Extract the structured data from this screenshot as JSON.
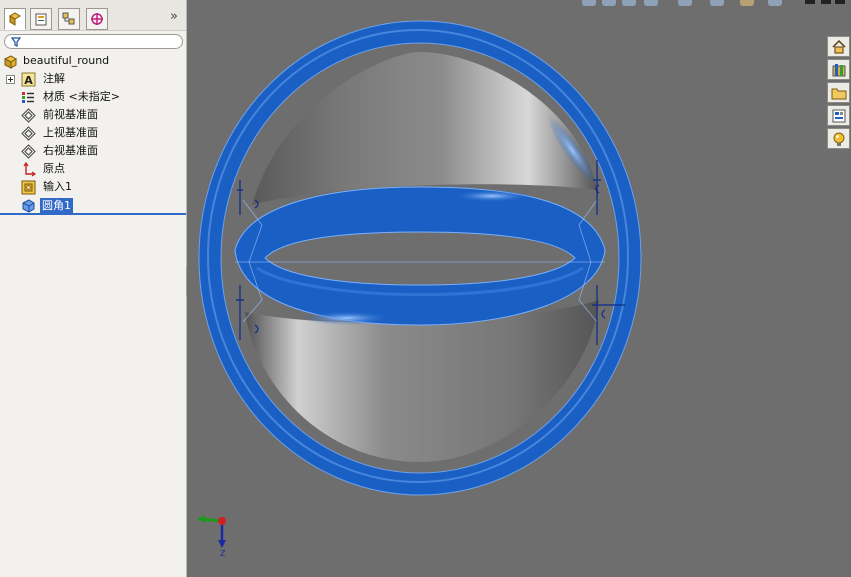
{
  "feature_tree": {
    "part_name": "beautiful_round",
    "items": [
      {
        "label": "注解",
        "icon": "annotation-icon",
        "expandable": true
      },
      {
        "label": "材质 <未指定>",
        "icon": "material-icon"
      },
      {
        "label": "前视基准面",
        "icon": "plane-icon"
      },
      {
        "label": "上视基准面",
        "icon": "plane-icon"
      },
      {
        "label": "右视基准面",
        "icon": "plane-icon"
      },
      {
        "label": "原点",
        "icon": "origin-icon"
      },
      {
        "label": "输入1",
        "icon": "imported-body-icon"
      },
      {
        "label": "圆角1",
        "icon": "fillet-icon",
        "selected": true
      }
    ]
  },
  "tabs": [
    "feature-manager-tab",
    "property-manager-tab",
    "configuration-manager-tab",
    "dimxpert-tab"
  ],
  "triad": {
    "z_label": "Z"
  },
  "colors": {
    "model_blue": "#1a5fc4",
    "selection": "#3169c6",
    "viewport_bg": "#6e6e6e"
  },
  "task_pane": [
    "home-icon",
    "design-library-icon",
    "file-explorer-icon",
    "view-palette-icon",
    "appearances-icon"
  ]
}
